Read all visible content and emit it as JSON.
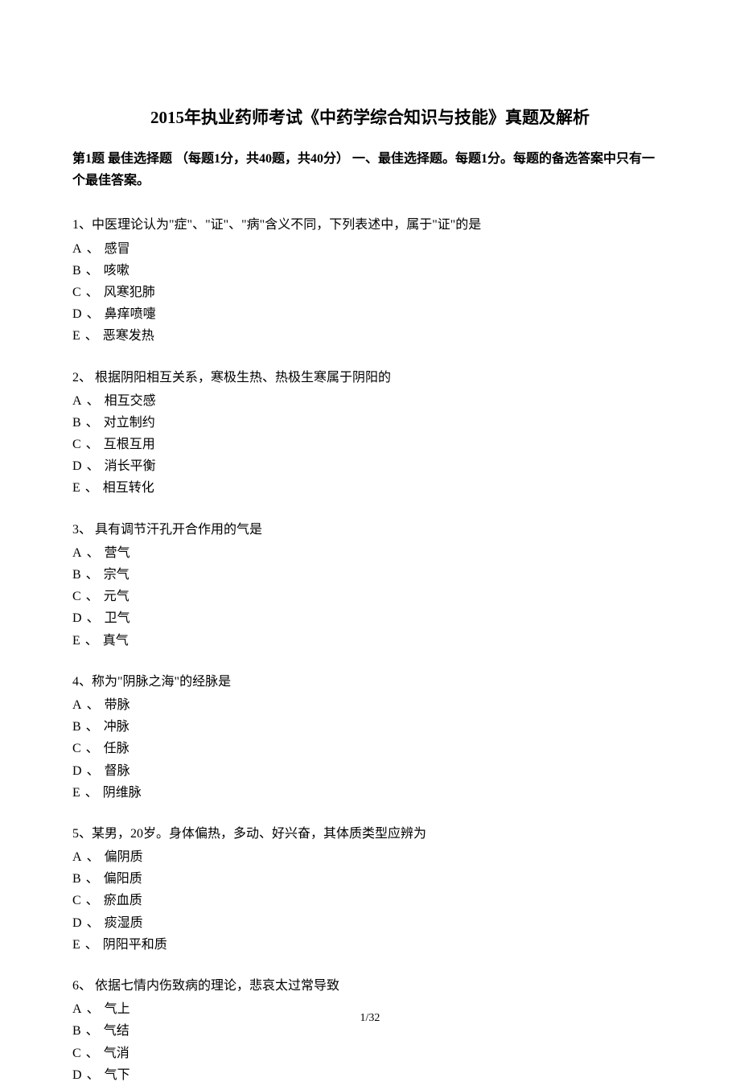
{
  "title": "2015年执业药师考试《中药学综合知识与技能》真题及解析",
  "section": {
    "label": "第1题 最佳选择题",
    "text": " （每题1分，共40题，共40分） 一、最佳选择题。每题1分。每题的备选答案中只有一个最佳答案。"
  },
  "questions": [
    {
      "num": "1、",
      "text": "中医理论认为\"症\"、\"证\"、\"病\"含义不同，下列表述中，属于\"证\"的是",
      "options": [
        {
          "letter": "A",
          "text": "感冒"
        },
        {
          "letter": "B",
          "text": "咳嗽"
        },
        {
          "letter": "C",
          "text": "风寒犯肺"
        },
        {
          "letter": "D",
          "text": "鼻痒喷嚏"
        },
        {
          "letter": "E",
          "text": "恶寒发热"
        }
      ]
    },
    {
      "num": "2、",
      "text": " 根据阴阳相互关系，寒极生热、热极生寒属于阴阳的",
      "options": [
        {
          "letter": "A",
          "text": "相互交感"
        },
        {
          "letter": "B",
          "text": "对立制约"
        },
        {
          "letter": "C",
          "text": "互根互用"
        },
        {
          "letter": "D",
          "text": "消长平衡"
        },
        {
          "letter": "E",
          "text": "相互转化"
        }
      ]
    },
    {
      "num": "3、",
      "text": " 具有调节汗孔开合作用的气是",
      "options": [
        {
          "letter": "A",
          "text": "营气"
        },
        {
          "letter": "B",
          "text": "宗气"
        },
        {
          "letter": "C",
          "text": "元气"
        },
        {
          "letter": "D",
          "text": "卫气"
        },
        {
          "letter": "E",
          "text": "真气"
        }
      ]
    },
    {
      "num": "4、",
      "text": "称为\"阴脉之海\"的经脉是",
      "options": [
        {
          "letter": "A",
          "text": "带脉"
        },
        {
          "letter": "B",
          "text": "冲脉"
        },
        {
          "letter": "C",
          "text": "任脉"
        },
        {
          "letter": "D",
          "text": "督脉"
        },
        {
          "letter": "E",
          "text": "阴维脉"
        }
      ]
    },
    {
      "num": "5、",
      "text": "某男，20岁。身体偏热，多动、好兴奋，其体质类型应辨为",
      "options": [
        {
          "letter": "A",
          "text": "偏阴质"
        },
        {
          "letter": "B",
          "text": "偏阳质"
        },
        {
          "letter": "C",
          "text": "瘀血质"
        },
        {
          "letter": "D",
          "text": "痰湿质"
        },
        {
          "letter": "E",
          "text": "阴阳平和质"
        }
      ]
    },
    {
      "num": "6、",
      "text": " 依据七情内伤致病的理论，悲哀太过常导致",
      "options": [
        {
          "letter": "A",
          "text": "气上"
        },
        {
          "letter": "B",
          "text": "气结"
        },
        {
          "letter": "C",
          "text": "气消"
        },
        {
          "letter": "D",
          "text": "气下"
        }
      ]
    }
  ],
  "option_separator": " 、 ",
  "page_number": "1/32"
}
